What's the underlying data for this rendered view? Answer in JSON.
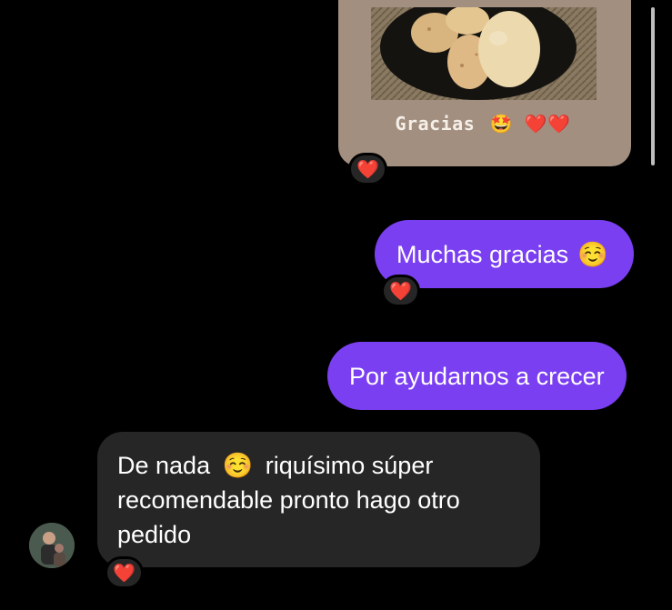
{
  "story_reply": {
    "caption_text": "Gracias",
    "caption_emojis": "🤩 ❤️❤️",
    "reaction": "❤️"
  },
  "messages": [
    {
      "text": "Muchas gracias",
      "emoji": "☺️",
      "reaction": "❤️"
    },
    {
      "text": "Por ayudarnos a crecer"
    },
    {
      "text_before": "De nada",
      "emoji": "☺️",
      "text_after": "riquísimo súper recomendable pronto hago otro pedido",
      "reaction": "❤️"
    }
  ],
  "colors": {
    "background": "#000000",
    "sent_bubble": "#7b3ff2",
    "received_bubble": "#262626",
    "story_card": "#a38f80",
    "heart": "#e0182d"
  }
}
